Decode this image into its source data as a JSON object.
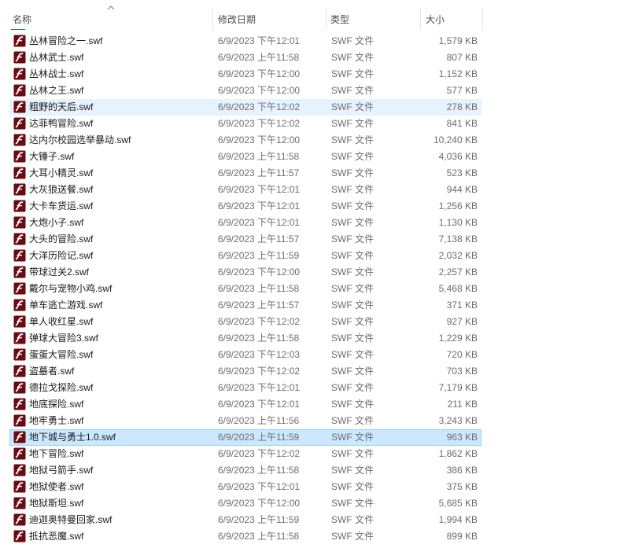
{
  "header": {
    "name_label": "名称",
    "date_label": "修改日期",
    "type_label": "类型",
    "size_label": "大小"
  },
  "colors": {
    "icon_bg": "#6b0a0f",
    "selected_bg": "#cce8ff",
    "hover_bg": "#e5f3ff"
  },
  "icon": "flash-swf-file-icon",
  "files": [
    {
      "name": "丛林冒险之一.swf",
      "date": "6/9/2023 下午12:01",
      "type": "SWF 文件",
      "size": "1,579 KB",
      "state": ""
    },
    {
      "name": "丛林武士.swf",
      "date": "6/9/2023 上午11:58",
      "type": "SWF 文件",
      "size": "807 KB",
      "state": ""
    },
    {
      "name": "丛林战士.swf",
      "date": "6/9/2023 下午12:00",
      "type": "SWF 文件",
      "size": "1,152 KB",
      "state": ""
    },
    {
      "name": "丛林之王.swf",
      "date": "6/9/2023 下午12:00",
      "type": "SWF 文件",
      "size": "577 KB",
      "state": ""
    },
    {
      "name": "粗野的天后.swf",
      "date": "6/9/2023 下午12:02",
      "type": "SWF 文件",
      "size": "278 KB",
      "state": "hover"
    },
    {
      "name": "达菲鸭冒险.swf",
      "date": "6/9/2023 下午12:02",
      "type": "SWF 文件",
      "size": "841 KB",
      "state": ""
    },
    {
      "name": "达内尔校园选举暴动.swf",
      "date": "6/9/2023 下午12:00",
      "type": "SWF 文件",
      "size": "10,240 KB",
      "state": ""
    },
    {
      "name": "大锤子.swf",
      "date": "6/9/2023 上午11:58",
      "type": "SWF 文件",
      "size": "4,036 KB",
      "state": ""
    },
    {
      "name": "大耳小精灵.swf",
      "date": "6/9/2023 上午11:57",
      "type": "SWF 文件",
      "size": "523 KB",
      "state": ""
    },
    {
      "name": "大灰狼送餐.swf",
      "date": "6/9/2023 下午12:01",
      "type": "SWF 文件",
      "size": "944 KB",
      "state": ""
    },
    {
      "name": "大卡车货运.swf",
      "date": "6/9/2023 下午12:01",
      "type": "SWF 文件",
      "size": "1,256 KB",
      "state": ""
    },
    {
      "name": "大炮小子.swf",
      "date": "6/9/2023 下午12:01",
      "type": "SWF 文件",
      "size": "1,130 KB",
      "state": ""
    },
    {
      "name": "大头的冒险.swf",
      "date": "6/9/2023 上午11:57",
      "type": "SWF 文件",
      "size": "7,138 KB",
      "state": ""
    },
    {
      "name": "大洋历险记.swf",
      "date": "6/9/2023 上午11:59",
      "type": "SWF 文件",
      "size": "2,032 KB",
      "state": ""
    },
    {
      "name": "带球过关2.swf",
      "date": "6/9/2023 下午12:00",
      "type": "SWF 文件",
      "size": "2,257 KB",
      "state": ""
    },
    {
      "name": "戴尔与宠物小鸡.swf",
      "date": "6/9/2023 上午11:58",
      "type": "SWF 文件",
      "size": "5,468 KB",
      "state": ""
    },
    {
      "name": "单车逃亡游戏.swf",
      "date": "6/9/2023 上午11:57",
      "type": "SWF 文件",
      "size": "371 KB",
      "state": ""
    },
    {
      "name": "单人收红星.swf",
      "date": "6/9/2023 下午12:02",
      "type": "SWF 文件",
      "size": "927 KB",
      "state": ""
    },
    {
      "name": "弹球大冒险3.swf",
      "date": "6/9/2023 上午11:58",
      "type": "SWF 文件",
      "size": "1,229 KB",
      "state": ""
    },
    {
      "name": "蛋蛋大冒险.swf",
      "date": "6/9/2023 下午12:03",
      "type": "SWF 文件",
      "size": "720 KB",
      "state": ""
    },
    {
      "name": "盗墓者.swf",
      "date": "6/9/2023 下午12:02",
      "type": "SWF 文件",
      "size": "703 KB",
      "state": ""
    },
    {
      "name": "德拉戈探险.swf",
      "date": "6/9/2023 下午12:01",
      "type": "SWF 文件",
      "size": "7,179 KB",
      "state": ""
    },
    {
      "name": "地底探险.swf",
      "date": "6/9/2023 下午12:01",
      "type": "SWF 文件",
      "size": "211 KB",
      "state": ""
    },
    {
      "name": "地牢勇士.swf",
      "date": "6/9/2023 上午11:56",
      "type": "SWF 文件",
      "size": "3,243 KB",
      "state": ""
    },
    {
      "name": "地下城与勇士1.0.swf",
      "date": "6/9/2023 上午11:59",
      "type": "SWF 文件",
      "size": "963 KB",
      "state": "selected"
    },
    {
      "name": "地下冒险.swf",
      "date": "6/9/2023 下午12:02",
      "type": "SWF 文件",
      "size": "1,862 KB",
      "state": ""
    },
    {
      "name": "地狱弓箭手.swf",
      "date": "6/9/2023 上午11:58",
      "type": "SWF 文件",
      "size": "386 KB",
      "state": ""
    },
    {
      "name": "地狱使者.swf",
      "date": "6/9/2023 下午12:01",
      "type": "SWF 文件",
      "size": "375 KB",
      "state": ""
    },
    {
      "name": "地狱斯坦.swf",
      "date": "6/9/2023 下午12:00",
      "type": "SWF 文件",
      "size": "5,685 KB",
      "state": ""
    },
    {
      "name": "迪迦奥特曼回家.swf",
      "date": "6/9/2023 上午11:59",
      "type": "SWF 文件",
      "size": "1,994 KB",
      "state": ""
    },
    {
      "name": "抵抗恶魔.swf",
      "date": "6/9/2023 上午11:58",
      "type": "SWF 文件",
      "size": "899 KB",
      "state": ""
    }
  ]
}
